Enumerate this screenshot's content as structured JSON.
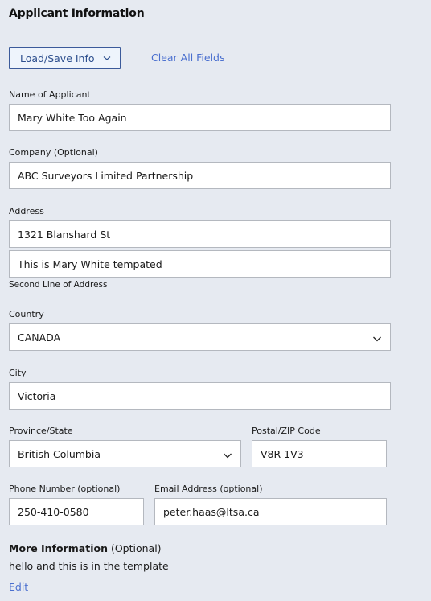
{
  "section": {
    "title": "Applicant Information"
  },
  "toolbar": {
    "load_save_label": "Load/Save Info",
    "clear_all_label": "Clear All Fields"
  },
  "fields": {
    "name": {
      "label": "Name of Applicant",
      "value": "Mary White Too Again"
    },
    "company": {
      "label": "Company (Optional)",
      "value": "ABC Surveyors Limited Partnership"
    },
    "address": {
      "label": "Address",
      "line1": "1321 Blanshard St",
      "line2": "This is Mary White tempated",
      "line2_hint": "Second Line of Address"
    },
    "country": {
      "label": "Country",
      "value": "CANADA"
    },
    "city": {
      "label": "City",
      "value": "Victoria"
    },
    "province": {
      "label": "Province/State",
      "value": "British Columbia"
    },
    "postal": {
      "label": "Postal/ZIP Code",
      "value": "V8R 1V3"
    },
    "phone": {
      "label": "Phone Number (optional)",
      "value": "250-410-0580"
    },
    "email": {
      "label": "Email Address (optional)",
      "value": "peter.haas@ltsa.ca"
    }
  },
  "more_info": {
    "heading": "More Information",
    "qualifier": " (Optional)",
    "text": "hello and this is in the template",
    "edit_label": "Edit"
  },
  "colors": {
    "background": "#e6eaf1",
    "link": "#4a6fcf",
    "button_border": "#3b5a9a"
  }
}
